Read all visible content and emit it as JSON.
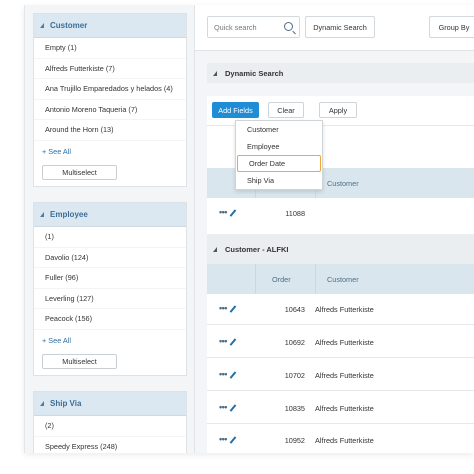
{
  "sidebar": {
    "customer": {
      "title": "Customer",
      "items": [
        "Empty (1)",
        "Alfreds Futterkiste (7)",
        "Ana Trujillo Emparedados y helados (4)",
        "Antonio Moreno Taqueria (7)",
        "Around the Horn (13)"
      ],
      "see_all": "+ See All",
      "multiselect": "Multiselect"
    },
    "employee": {
      "title": "Employee",
      "items": [
        "(1)",
        "Davolio (124)",
        "Fuller (96)",
        "Leverling (127)",
        "Peacock (156)"
      ],
      "see_all": "+ See All",
      "multiselect": "Multiselect"
    },
    "shipvia": {
      "title": "Ship Via",
      "items": [
        "(2)",
        "Speedy Express (248)"
      ]
    }
  },
  "toolbar": {
    "search_placeholder": "Quick search",
    "dynamic_search": "Dynamic Search",
    "group_by": "Group By"
  },
  "dynamic_search": {
    "title": "Dynamic Search",
    "add_fields": "Add Fields",
    "clear": "Clear",
    "apply": "Apply",
    "fields": [
      "Customer",
      "Employee",
      "Order Date",
      "Ship Via"
    ],
    "highlighted_field": "Order Date"
  },
  "grid": {
    "col_customer": "Customer",
    "col_order": "Order",
    "first_row_order": "11088",
    "group_title": "Customer - ALFKI",
    "rows": [
      {
        "order": "10643",
        "customer": "Alfreds Futterkiste"
      },
      {
        "order": "10692",
        "customer": "Alfreds Futterkiste"
      },
      {
        "order": "10702",
        "customer": "Alfreds Futterkiste"
      },
      {
        "order": "10835",
        "customer": "Alfreds Futterkiste"
      },
      {
        "order": "10952",
        "customer": "Alfreds Futterkiste"
      }
    ]
  },
  "colors": {
    "accent": "#1f8dd6",
    "facet_header": "#dbe8f1",
    "highlight": "#f0a83a"
  }
}
